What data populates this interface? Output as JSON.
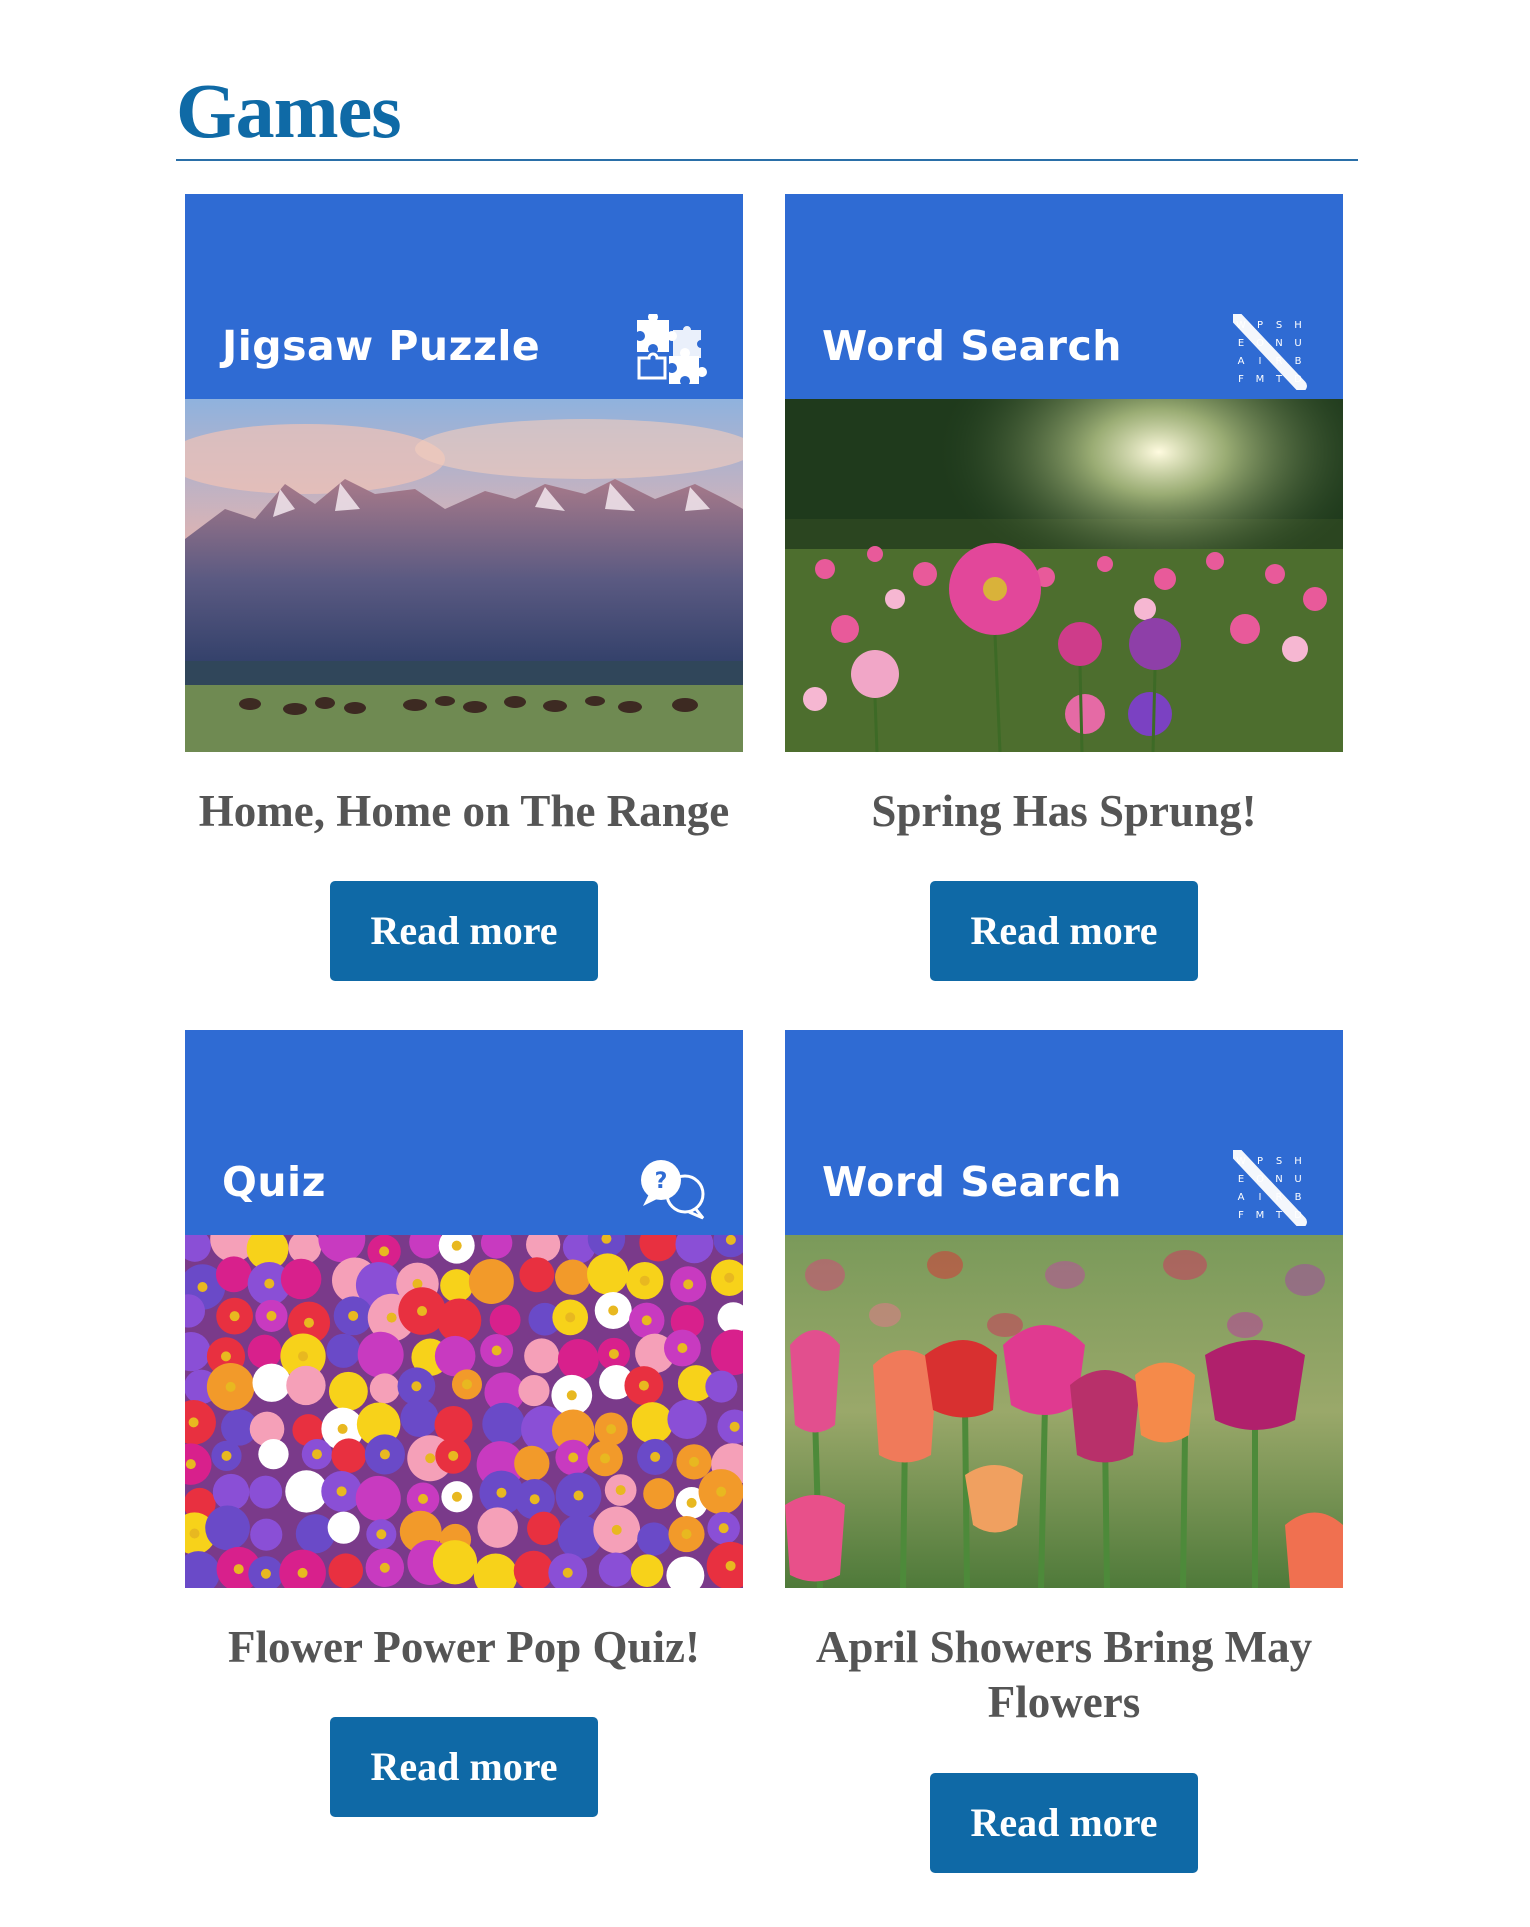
{
  "section": {
    "title": "Games"
  },
  "cards": [
    {
      "category": "Jigsaw Puzzle",
      "icon": "puzzle-pieces-icon",
      "image": "mountain-range-with-bison-photo",
      "title": "Home, Home on The Range",
      "button": "Read more"
    },
    {
      "category": "Word Search",
      "icon": "word-search-grid-icon",
      "image": "cosmos-flower-field-photo",
      "title": "Spring Has Sprung!",
      "button": "Read more"
    },
    {
      "category": "Quiz",
      "icon": "quiz-speech-bubbles-icon",
      "image": "colorful-flower-mosaic-photo",
      "title": "Flower Power Pop Quiz!",
      "button": "Read more"
    },
    {
      "category": "Word Search",
      "icon": "word-search-grid-icon",
      "image": "tulip-field-photo",
      "title": "April Showers Bring May Flowers",
      "button": "Read more"
    }
  ],
  "word_search_letters": [
    "W",
    "P",
    "S",
    "H",
    "E",
    "O",
    "N",
    "U",
    "A",
    "I",
    "R",
    "B",
    "F",
    "M",
    "T",
    "D"
  ],
  "colors": {
    "accent": "#0f6aa6",
    "banner": "#2f6bd3",
    "button": "#0f69a6",
    "card_title": "#555555"
  }
}
